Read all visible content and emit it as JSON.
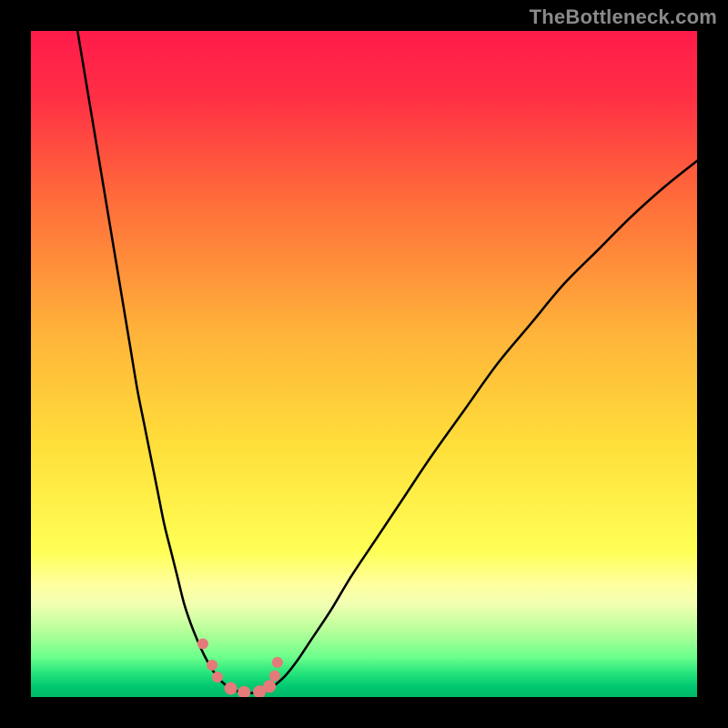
{
  "watermark": "TheBottleneck.com",
  "colors": {
    "frame": "#000000",
    "curve_stroke": "#000000",
    "marker_fill": "#e47a79",
    "gradient_stops": [
      {
        "offset": 0.0,
        "color": "#ff1b4b"
      },
      {
        "offset": 0.1,
        "color": "#ff2f45"
      },
      {
        "offset": 0.25,
        "color": "#ff6b3a"
      },
      {
        "offset": 0.45,
        "color": "#ffb23a"
      },
      {
        "offset": 0.62,
        "color": "#ffde3a"
      },
      {
        "offset": 0.78,
        "color": "#ffff55"
      },
      {
        "offset": 0.83,
        "color": "#ffff9e"
      },
      {
        "offset": 0.86,
        "color": "#f2ffb2"
      },
      {
        "offset": 0.9,
        "color": "#b8ff9a"
      },
      {
        "offset": 0.94,
        "color": "#6cff8c"
      },
      {
        "offset": 0.965,
        "color": "#22e37a"
      },
      {
        "offset": 0.985,
        "color": "#00c670"
      },
      {
        "offset": 1.0,
        "color": "#00b867"
      }
    ]
  },
  "chart_data": {
    "type": "line",
    "title": "",
    "xlabel": "",
    "ylabel": "",
    "xlim": [
      0,
      100
    ],
    "ylim": [
      0,
      100
    ],
    "grid": false,
    "series": [
      {
        "name": "left-branch",
        "x": [
          7,
          8,
          9,
          10,
          11,
          12,
          13,
          14,
          15,
          16,
          17,
          18,
          19,
          20,
          21,
          22,
          23,
          24,
          25,
          26,
          27,
          28,
          29,
          30
        ],
        "y": [
          100,
          94,
          88,
          82,
          76,
          70,
          64,
          58,
          52,
          46,
          41,
          36,
          31,
          26,
          22,
          18,
          14,
          11,
          8.5,
          6.3,
          4.5,
          3.0,
          2.0,
          1.3
        ]
      },
      {
        "name": "valley",
        "x": [
          30,
          31,
          32,
          33,
          34,
          35,
          36
        ],
        "y": [
          1.3,
          0.9,
          0.7,
          0.6,
          0.7,
          0.9,
          1.3
        ]
      },
      {
        "name": "right-branch",
        "x": [
          36,
          38,
          40,
          42,
          45,
          48,
          52,
          56,
          60,
          65,
          70,
          75,
          80,
          85,
          90,
          95,
          100
        ],
        "y": [
          1.3,
          3.0,
          5.5,
          8.5,
          13,
          18,
          24,
          30,
          36,
          43,
          50,
          56,
          62,
          67,
          72,
          76.5,
          80.5
        ]
      }
    ],
    "markers": {
      "name": "highlight-points",
      "x": [
        25.8,
        27.2,
        28.0,
        30.0,
        32.0,
        34.3,
        35.8,
        36.6,
        37.0
      ],
      "y": [
        8.0,
        4.8,
        3.0,
        1.3,
        0.7,
        0.8,
        1.6,
        3.2,
        5.2
      ],
      "r": [
        6,
        6,
        6,
        7,
        7,
        7,
        7,
        6,
        6
      ]
    }
  }
}
